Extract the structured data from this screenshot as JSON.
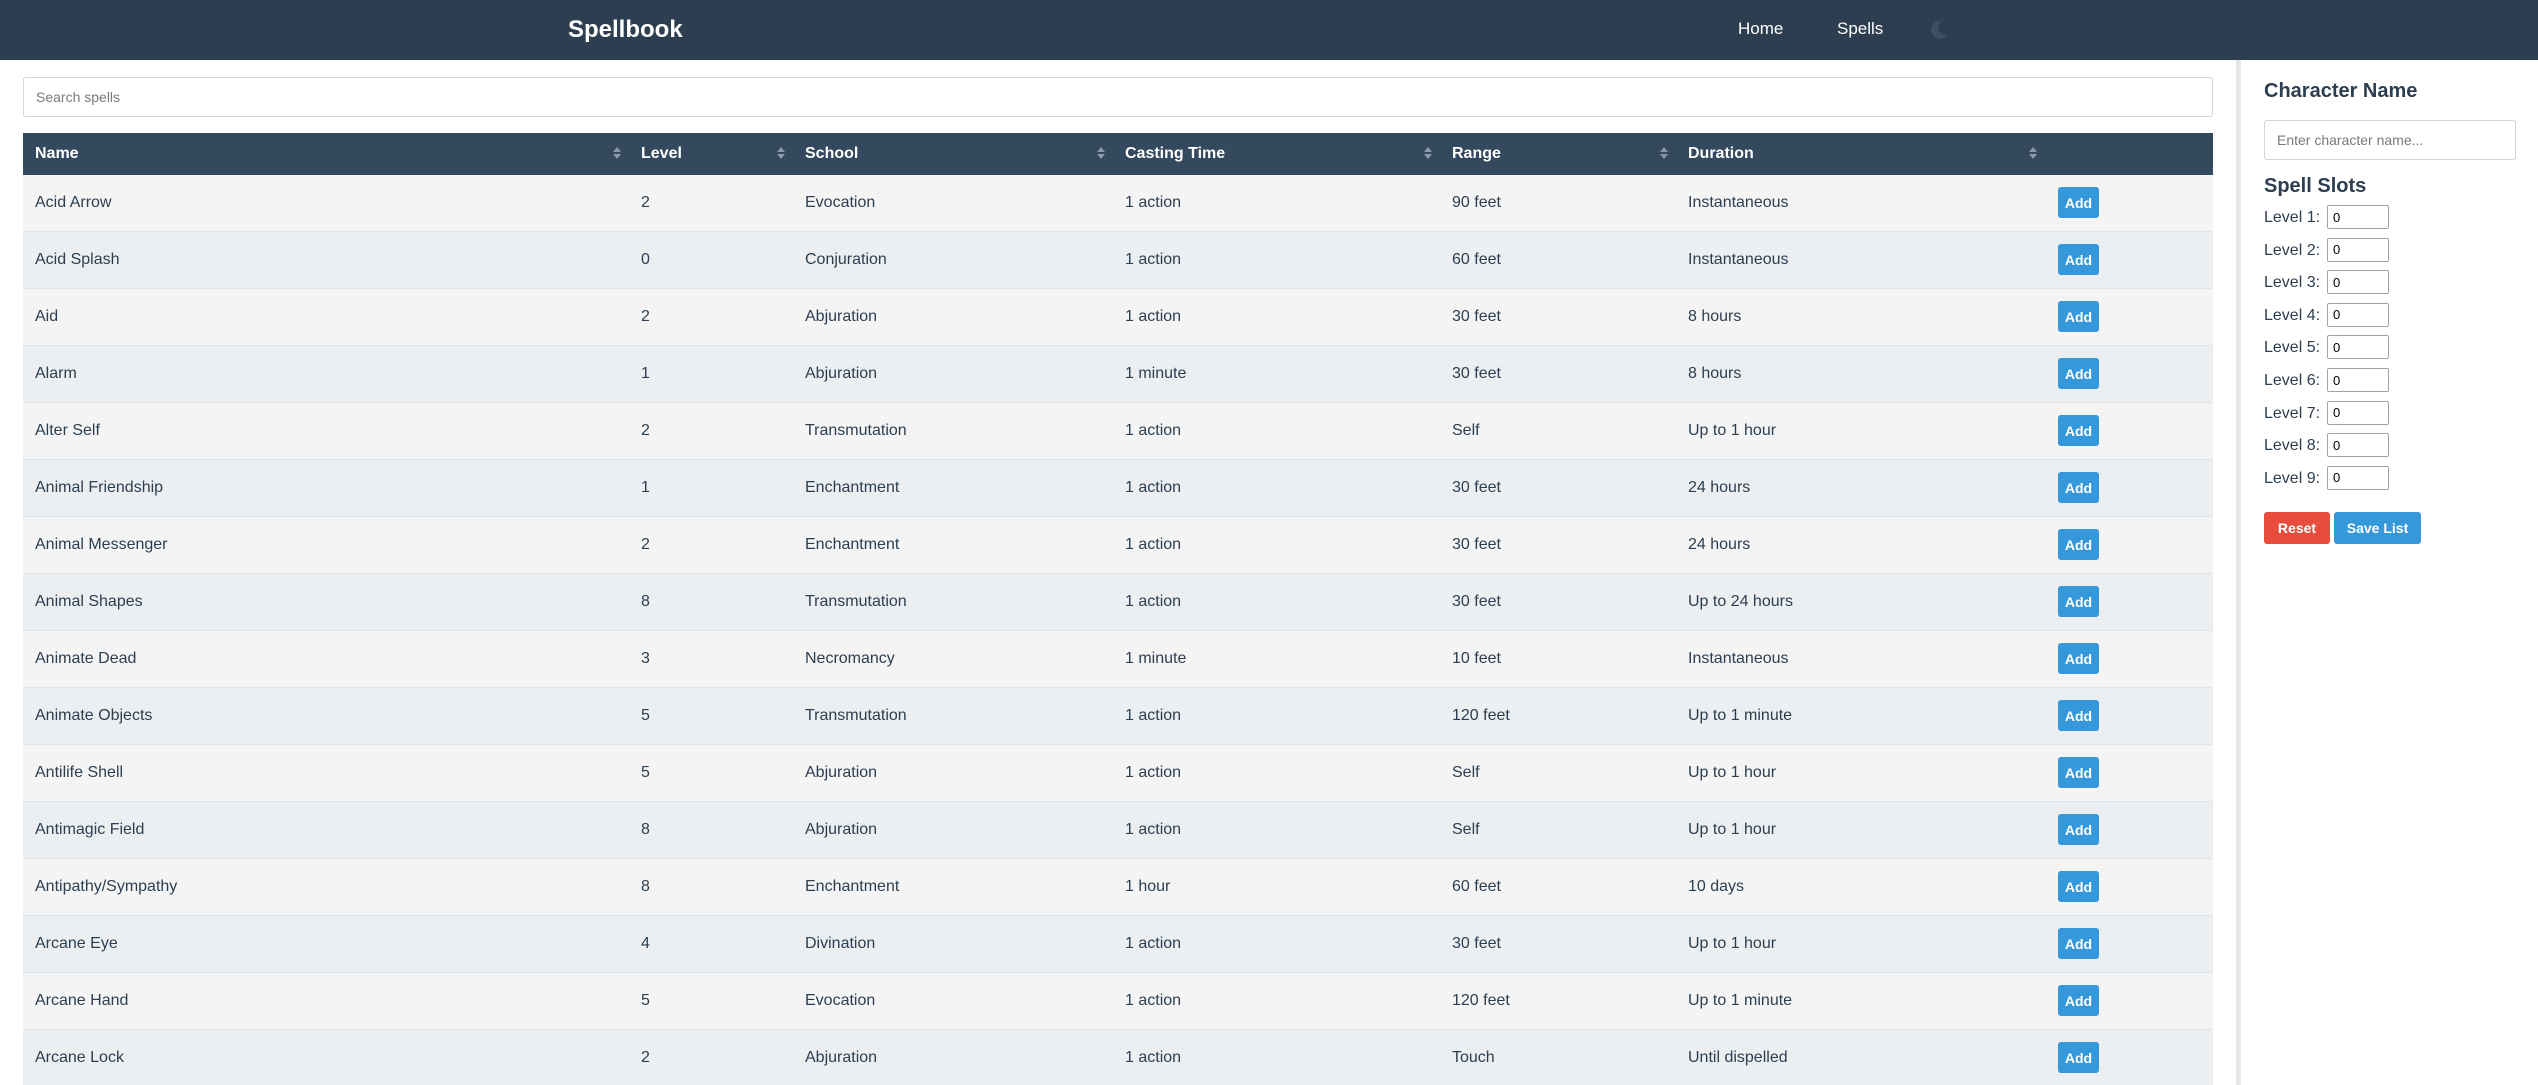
{
  "app": {
    "title": "Spellbook"
  },
  "nav": {
    "home": "Home",
    "spells": "Spells",
    "theme_icon": "moon-icon"
  },
  "search": {
    "placeholder": "Search spells",
    "value": ""
  },
  "table": {
    "headers": [
      "Name",
      "Level",
      "School",
      "Casting Time",
      "Range",
      "Duration"
    ],
    "add_label": "Add",
    "rows": [
      {
        "name": "Acid Arrow",
        "level": "2",
        "school": "Evocation",
        "casting_time": "1 action",
        "range": "90 feet",
        "duration": "Instantaneous"
      },
      {
        "name": "Acid Splash",
        "level": "0",
        "school": "Conjuration",
        "casting_time": "1 action",
        "range": "60 feet",
        "duration": "Instantaneous"
      },
      {
        "name": "Aid",
        "level": "2",
        "school": "Abjuration",
        "casting_time": "1 action",
        "range": "30 feet",
        "duration": "8 hours"
      },
      {
        "name": "Alarm",
        "level": "1",
        "school": "Abjuration",
        "casting_time": "1 minute",
        "range": "30 feet",
        "duration": "8 hours"
      },
      {
        "name": "Alter Self",
        "level": "2",
        "school": "Transmutation",
        "casting_time": "1 action",
        "range": "Self",
        "duration": "Up to 1 hour"
      },
      {
        "name": "Animal Friendship",
        "level": "1",
        "school": "Enchantment",
        "casting_time": "1 action",
        "range": "30 feet",
        "duration": "24 hours"
      },
      {
        "name": "Animal Messenger",
        "level": "2",
        "school": "Enchantment",
        "casting_time": "1 action",
        "range": "30 feet",
        "duration": "24 hours"
      },
      {
        "name": "Animal Shapes",
        "level": "8",
        "school": "Transmutation",
        "casting_time": "1 action",
        "range": "30 feet",
        "duration": "Up to 24 hours"
      },
      {
        "name": "Animate Dead",
        "level": "3",
        "school": "Necromancy",
        "casting_time": "1 minute",
        "range": "10 feet",
        "duration": "Instantaneous"
      },
      {
        "name": "Animate Objects",
        "level": "5",
        "school": "Transmutation",
        "casting_time": "1 action",
        "range": "120 feet",
        "duration": "Up to 1 minute"
      },
      {
        "name": "Antilife Shell",
        "level": "5",
        "school": "Abjuration",
        "casting_time": "1 action",
        "range": "Self",
        "duration": "Up to 1 hour"
      },
      {
        "name": "Antimagic Field",
        "level": "8",
        "school": "Abjuration",
        "casting_time": "1 action",
        "range": "Self",
        "duration": "Up to 1 hour"
      },
      {
        "name": "Antipathy/Sympathy",
        "level": "8",
        "school": "Enchantment",
        "casting_time": "1 hour",
        "range": "60 feet",
        "duration": "10 days"
      },
      {
        "name": "Arcane Eye",
        "level": "4",
        "school": "Divination",
        "casting_time": "1 action",
        "range": "30 feet",
        "duration": "Up to 1 hour"
      },
      {
        "name": "Arcane Hand",
        "level": "5",
        "school": "Evocation",
        "casting_time": "1 action",
        "range": "120 feet",
        "duration": "Up to 1 minute"
      },
      {
        "name": "Arcane Lock",
        "level": "2",
        "school": "Abjuration",
        "casting_time": "1 action",
        "range": "Touch",
        "duration": "Until dispelled"
      }
    ]
  },
  "sidebar": {
    "character_title": "Character Name",
    "character_placeholder": "Enter character name...",
    "character_value": "",
    "slots_title": "Spell Slots",
    "slots": [
      {
        "label": "Level 1:",
        "value": "0"
      },
      {
        "label": "Level 2:",
        "value": "0"
      },
      {
        "label": "Level 3:",
        "value": "0"
      },
      {
        "label": "Level 4:",
        "value": "0"
      },
      {
        "label": "Level 5:",
        "value": "0"
      },
      {
        "label": "Level 6:",
        "value": "0"
      },
      {
        "label": "Level 7:",
        "value": "0"
      },
      {
        "label": "Level 8:",
        "value": "0"
      },
      {
        "label": "Level 9:",
        "value": "0"
      }
    ],
    "reset_label": "Reset",
    "save_label": "Save List"
  },
  "colors": {
    "navbar": "#2c3e50",
    "table_header": "#34495e",
    "primary": "#3498db",
    "danger": "#e74c3c"
  }
}
